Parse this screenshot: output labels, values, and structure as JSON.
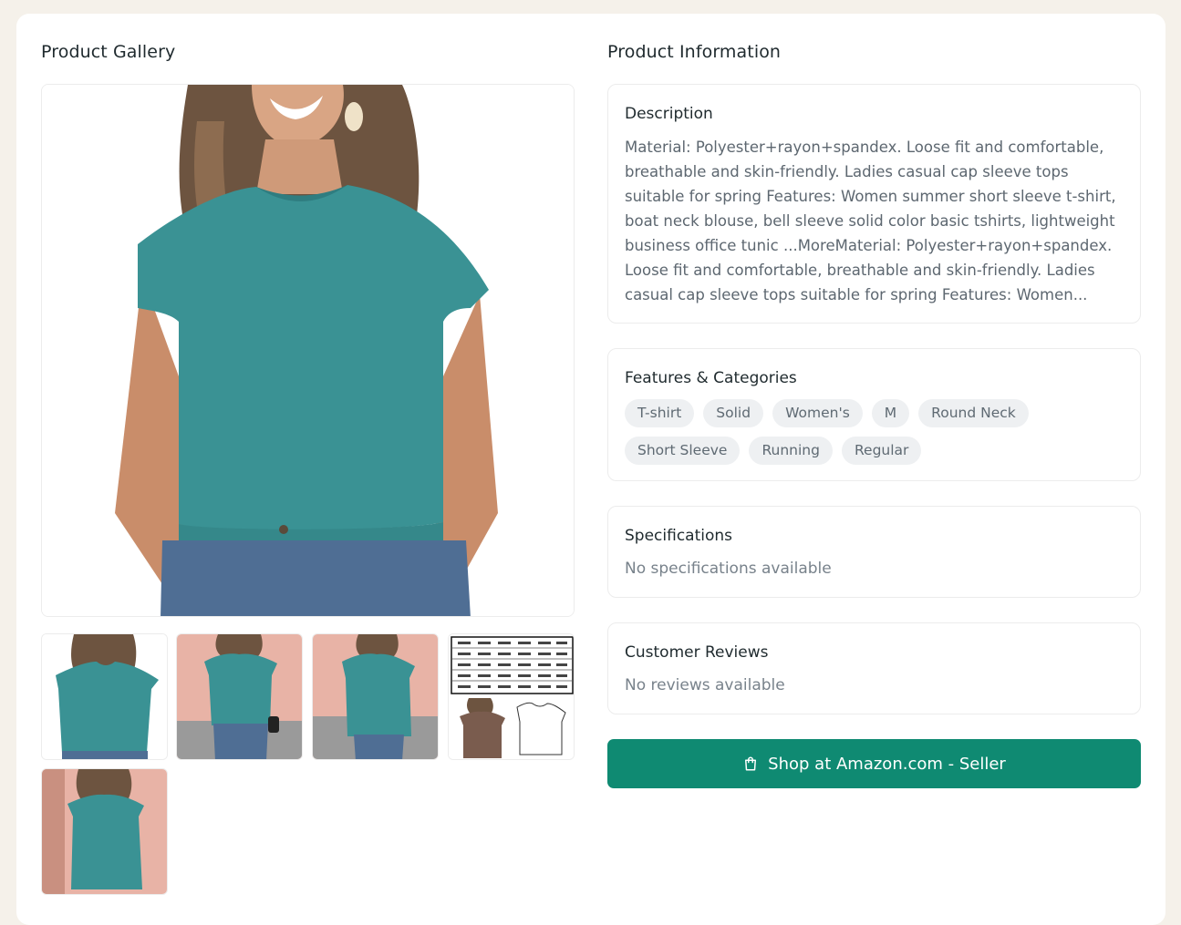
{
  "gallery": {
    "title": "Product Gallery",
    "thumbnails": [
      "front",
      "street-front",
      "street-side",
      "size-chart",
      "street-close"
    ]
  },
  "info": {
    "title": "Product Information",
    "description": {
      "heading": "Description",
      "text": "Material: Polyester+rayon+spandex. Loose fit and comfortable, breathable and skin-friendly. Ladies casual cap sleeve tops suitable for spring Features: Women summer short sleeve t-shirt, boat neck blouse, bell sleeve solid color basic tshirts, lightweight business office tunic ...MoreMaterial: Polyester+rayon+spandex. Loose fit and comfortable, breathable and skin-friendly. Ladies casual cap sleeve tops suitable for spring Features: Women..."
    },
    "features": {
      "heading": "Features & Categories",
      "tags": [
        "T-shirt",
        "Solid",
        "Women's",
        "M",
        "Round Neck",
        "Short Sleeve",
        "Running",
        "Regular"
      ]
    },
    "specifications": {
      "heading": "Specifications",
      "empty": "No specifications available"
    },
    "reviews": {
      "heading": "Customer Reviews",
      "empty": "No reviews available"
    },
    "shop_button": {
      "label": "Shop at Amazon.com - Seller",
      "icon": "shopping-bag-icon"
    }
  },
  "colors": {
    "accent": "#0f8a72",
    "shirt": "#3a9294",
    "page_bg": "#f5f1ea"
  }
}
